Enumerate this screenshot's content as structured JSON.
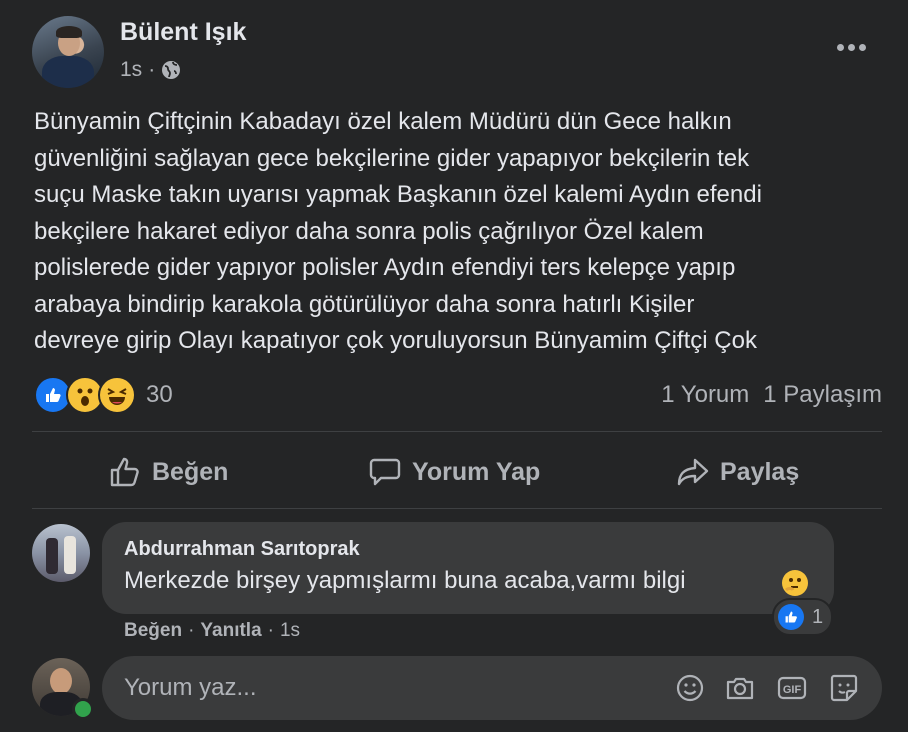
{
  "post": {
    "author": "Bülent Işık",
    "time": "1s",
    "separator": "·",
    "text": "Bünyamin Çiftçinin Kabadayı özel kalem Müdürü dün Gece halkın\ngüvenliğini sağlayan gece bekçilerine gider yapapıyor bekçilerin tek\nsuçu Maske takın uyarısı yapmak Başkanın özel kalemi Aydın efendi\nbekçilere hakaret ediyor daha sonra polis çağrılıyor Özel kalem\npolislerede gider yapıyor polisler Aydın efendiyi ters kelepçe yapıp\narabaya bindirip karakola götürülüyor daha sonra hatırlı Kişiler\ndevreye girip Olayı kapatıyor çok yoruluyorsun Bünyamim Çiftçi Çok",
    "reaction_count": "30",
    "reaction_icons": [
      "like-icon",
      "wow-icon",
      "haha-icon"
    ],
    "comments_label": "1 Yorum",
    "shares_label": "1 Paylaşım"
  },
  "actions": {
    "like": "Beğen",
    "comment": "Yorum Yap",
    "share": "Paylaş"
  },
  "comment": {
    "author": "Abdurrahman Sarıtoprak",
    "text": "Merkezde birşey yapmışlarmı buna acaba,varmı bilgi",
    "reaction_count": "1",
    "like_label": "Beğen",
    "reply_label": "Yanıtla",
    "separator": "·",
    "time": "1s"
  },
  "composer": {
    "placeholder": "Yorum yaz..."
  },
  "colors": {
    "background": "#242526",
    "bubble": "#3a3b3c",
    "primary_text": "#e4e6eb",
    "secondary_text": "#b0b3b8",
    "like_blue": "#1877f2",
    "online_green": "#31a24c"
  }
}
